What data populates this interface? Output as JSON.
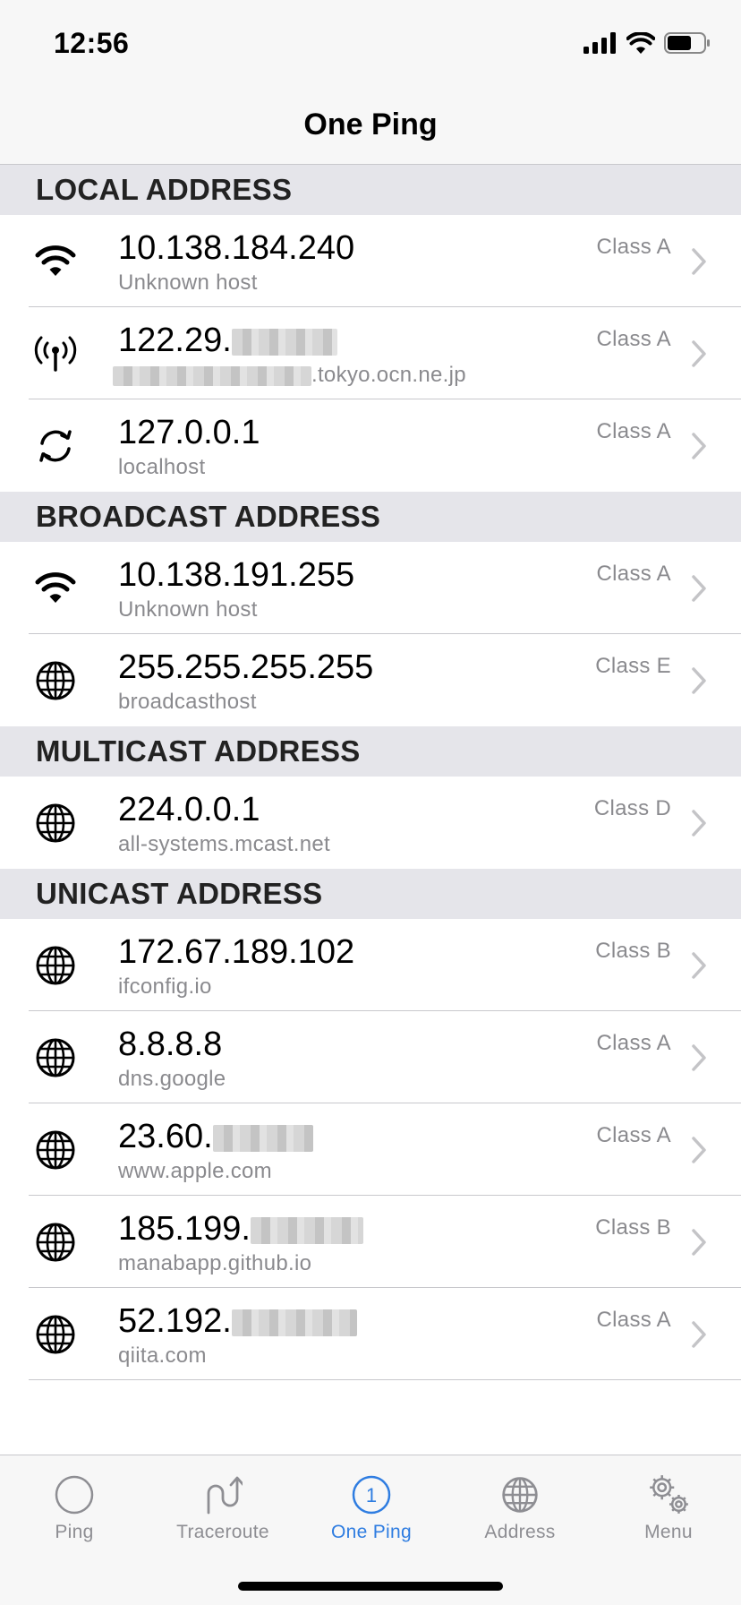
{
  "status": {
    "time": "12:56"
  },
  "nav": {
    "title": "One Ping"
  },
  "colors": {
    "accent": "#2f7de1",
    "secondary_text": "#8a8a8e",
    "section_bg": "#e5e5ea"
  },
  "sections": [
    {
      "title": "LOCAL ADDRESS",
      "rows": [
        {
          "icon": "wifi-icon",
          "address": "10.138.184.240",
          "host": "Unknown host",
          "class": "Class A"
        },
        {
          "icon": "antenna-icon",
          "address": "122.29.",
          "host": ".tokyo.ocn.ne.jp",
          "class": "Class A"
        },
        {
          "icon": "loopback-icon",
          "address": "127.0.0.1",
          "host": "localhost",
          "class": "Class A"
        }
      ]
    },
    {
      "title": "BROADCAST ADDRESS",
      "rows": [
        {
          "icon": "wifi-icon",
          "address": "10.138.191.255",
          "host": "Unknown host",
          "class": "Class A"
        },
        {
          "icon": "globe-icon",
          "address": "255.255.255.255",
          "host": "broadcasthost",
          "class": "Class E"
        }
      ]
    },
    {
      "title": "MULTICAST ADDRESS",
      "rows": [
        {
          "icon": "globe-icon",
          "address": "224.0.0.1",
          "host": "all-systems.mcast.net",
          "class": "Class D"
        }
      ]
    },
    {
      "title": "UNICAST ADDRESS",
      "rows": [
        {
          "icon": "globe-icon",
          "address": "172.67.189.102",
          "host": "ifconfig.io",
          "class": "Class B"
        },
        {
          "icon": "globe-icon",
          "address": "8.8.8.8",
          "host": "dns.google",
          "class": "Class A"
        },
        {
          "icon": "globe-icon",
          "address": "23.60.",
          "host": "www.apple.com",
          "class": "Class A"
        },
        {
          "icon": "globe-icon",
          "address": "185.199.",
          "host": "manabapp.github.io",
          "class": "Class B"
        },
        {
          "icon": "globe-icon",
          "address": "52.192.",
          "host": "qiita.com",
          "class": "Class A"
        }
      ]
    }
  ],
  "tabs": [
    {
      "label": "Ping",
      "icon": "circle-icon"
    },
    {
      "label": "Traceroute",
      "icon": "traceroute-icon"
    },
    {
      "label": "One Ping",
      "icon": "one-ping-icon",
      "badge": "1",
      "active": true
    },
    {
      "label": "Address",
      "icon": "globe-icon"
    },
    {
      "label": "Menu",
      "icon": "gear-icon"
    }
  ]
}
